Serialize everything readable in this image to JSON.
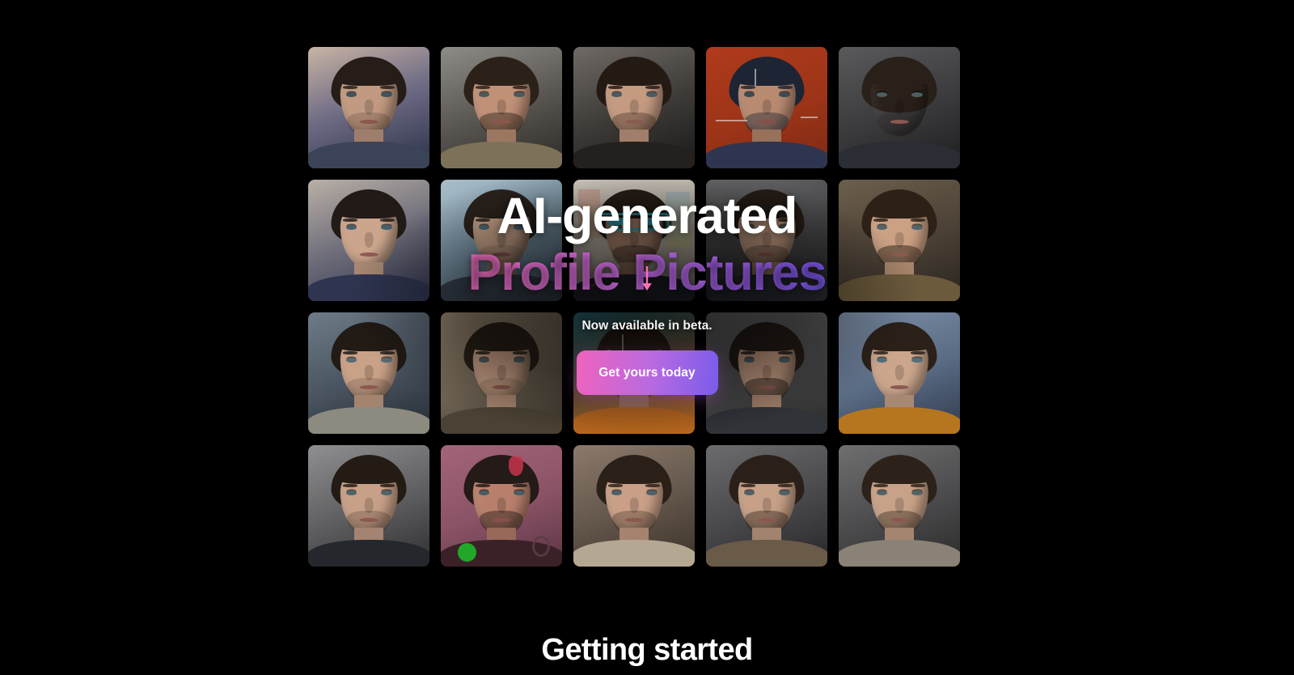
{
  "page": {
    "background_color": "#000000"
  },
  "hero": {
    "headline_line1": "AI-generated",
    "headline_line2": "Profile Pictures",
    "subhead": "Now available in beta.",
    "cta_label": "Get yours today",
    "scroll_hint_icon": "arrow-down-icon",
    "colors": {
      "gradient_start": "#f56fc0",
      "gradient_mid": "#c46ae4",
      "gradient_end": "#7a57f0",
      "button_start": "#ef63bd",
      "button_end": "#7a5ceb",
      "arrow": "#f472b6",
      "headline_text": "#ffffff",
      "subhead_text": "#f2f2f2"
    },
    "gallery": {
      "columns": 5,
      "rows": 4,
      "tiles": [
        {
          "alt": "AI portrait 1",
          "bg": "linear-gradient(160deg,#c9b4a4 0%,#6d6a84 48%,#2b3048 100%)",
          "skin": "#c19a81",
          "hair": "#271d18",
          "cloth": "#3b4358",
          "eye": "#3f5560",
          "lips": "#8a5750",
          "beard": 0.18,
          "accent": "none"
        },
        {
          "alt": "AI portrait 2",
          "bg": "linear-gradient(160deg,#8e8c86 0%,#56534e 55%,#2c2a27 100%)",
          "skin": "#c09077",
          "hair": "#2b2119",
          "cloth": "#7d7259",
          "eye": "#4b5a5c",
          "lips": "#8d564c",
          "beard": 0.45,
          "accent": "none"
        },
        {
          "alt": "AI portrait 3",
          "bg": "linear-gradient(160deg,#6f6a66 0%,#3b3835 55%,#1b1a19 100%)",
          "skin": "#c49a80",
          "hair": "#241a14",
          "cloth": "#24201d",
          "eye": "#4a5b61",
          "lips": "#8b5a51",
          "beard": 0.32,
          "accent": "none"
        },
        {
          "alt": "AI portrait 4",
          "bg": "linear-gradient(160deg,#b03a1c 0%,#9c3418 55%,#7d2a13 100%)",
          "skin": "#b88a70",
          "hair": "#1d2433",
          "cloth": "#2d3550",
          "eye": "#3c4a55",
          "lips": "#84504a",
          "beard": 0.42,
          "accent": "lines"
        },
        {
          "alt": "AI portrait 5",
          "bg": "linear-gradient(160deg,#5a5a5c 0%,#3a3a3c 55%,#1e1e20 100%)",
          "skin": "#c09madd",
          "hair": "#2a201a",
          "cloth": "#2a2d33",
          "eye": "#4d5e63",
          "lips": "#8b5850",
          "beard": 0.2,
          "accent": "none"
        },
        {
          "alt": "AI portrait 6",
          "bg": "linear-gradient(160deg,#b9b0a6 0%,#6b6a78 52%,#31364d 100%)",
          "skin": "#cba58c",
          "hair": "#221a16",
          "cloth": "#2f3550",
          "eye": "#46606c",
          "lips": "#8e5c55",
          "beard": 0.0,
          "accent": "none"
        },
        {
          "alt": "AI portrait 7",
          "bg": "linear-gradient(160deg,#a9bdc9 0%,#7b96a8 52%,#4c6173 100%)",
          "skin": "#cfa88e",
          "hair": "#2b221c",
          "cloth": "#3a4450",
          "eye": "#50707c",
          "lips": "#8f5d54",
          "beard": 0.12,
          "accent": "none"
        },
        {
          "alt": "AI portrait 8",
          "bg": "linear-gradient(160deg,#ddd6cb 0%,#c8bfb2 52%,#a89c8d 100%)",
          "skin": "#c79a7e",
          "hair": "#2a2018",
          "cloth": "#262b33",
          "eye": "#3f5a63",
          "lips": "#8a564d",
          "beard": 0.4,
          "accent": "cyber"
        },
        {
          "alt": "AI portrait 9",
          "bg": "linear-gradient(160deg,#6b6b6d 0%,#404042 55%,#232325 100%)",
          "skin": "#c49c83",
          "hair": "#241b15",
          "cloth": "#2b2e34",
          "eye": "#4b5e64",
          "lips": "#8b5950",
          "beard": 0.3,
          "accent": "none"
        },
        {
          "alt": "AI portrait 10",
          "bg": "linear-gradient(160deg,#6d5f4c 0%,#4a4035 55%,#2a251e 100%)",
          "skin": "#cba083",
          "hair": "#2d2117",
          "cloth": "#6b5a3c",
          "eye": "#52656a",
          "lips": "#8e5a50",
          "beard": 0.5,
          "accent": "none"
        },
        {
          "alt": "AI portrait 11",
          "bg": "linear-gradient(160deg,#6f7b88 0%,#47525e 55%,#242a31 100%)",
          "skin": "#c9a187",
          "hair": "#211a15",
          "cloth": "#8d8a80",
          "eye": "#566c74",
          "lips": "#8c5950",
          "beard": 0.16,
          "accent": "none"
        },
        {
          "alt": "AI portrait 12",
          "bg": "linear-gradient(160deg,#9d8c74 0%,#6d6252 55%,#3a352c 100%)",
          "skin": "#c9a086",
          "hair": "#2a2018",
          "cloth": "#4a4234",
          "eye": "#4e6067",
          "lips": "#8b5850",
          "beard": 0.14,
          "accent": "none"
        },
        {
          "alt": "AI portrait 13",
          "bg": "linear-gradient(160deg,#2e7a8e 0%,#7a5a34 52%,#b86a22 100%)",
          "skin": "#c2926f",
          "hair": "#2c2017",
          "cloth": "#b8671f",
          "eye": "#47606a",
          "lips": "#8a554a",
          "beard": 0.45,
          "accent": "lines"
        },
        {
          "alt": "AI portrait 14",
          "bg": "linear-gradient(160deg,#6e6e70 0%,#49494b 55%,#292929 100%)",
          "skin": "#c39a80",
          "hair": "#241c16",
          "cloth": "#303338",
          "eye": "#4c5f66",
          "lips": "#8a5850",
          "beard": 0.5,
          "accent": "none"
        },
        {
          "alt": "AI portrait 15",
          "bg": "linear-gradient(160deg,#7e8fa8 0%,#5a6b84 52%,#303a4e 100%)",
          "skin": "#cba68d",
          "hair": "#2b2119",
          "cloth": "#b5761f",
          "eye": "#52707d",
          "lips": "#8d5b52",
          "beard": 0.0,
          "accent": "none"
        },
        {
          "alt": "AI portrait 16",
          "bg": "linear-gradient(160deg,#8f8f91 0%,#5c5c5e 55%,#2e2e30 100%)",
          "skin": "#c8a088",
          "hair": "#241b15",
          "cloth": "#24272c",
          "eye": "#506469",
          "lips": "#8b5950",
          "beard": 0.22,
          "accent": "none"
        },
        {
          "alt": "AI portrait 17",
          "bg": "linear-gradient(160deg,#a3647a 0%,#8b5366 52%,#5c3445 100%)",
          "skin": "#b8806c",
          "hair": "#241a18",
          "cloth": "#3a2128",
          "eye": "#4a5c63",
          "lips": "#8a4f4a",
          "beard": 0.46,
          "accent": "pinkroom"
        },
        {
          "alt": "AI portrait 18",
          "bg": "linear-gradient(160deg,#8c7a6c 0%,#63564b 52%,#3a3229 100%)",
          "skin": "#c9a087",
          "hair": "#2b2018",
          "cloth": "#b5a893",
          "eye": "#4e6167",
          "lips": "#8b5850",
          "beard": 0.3,
          "accent": "none"
        },
        {
          "alt": "AI portrait 19",
          "bg": "linear-gradient(160deg,#6c6c6e 0%,#47474a 55%,#27272a 100%)",
          "skin": "#c6a087",
          "hair": "#2a2019",
          "cloth": "#6a5a48",
          "eye": "#4e6268",
          "lips": "#8b5850",
          "beard": 0.42,
          "accent": "none"
        },
        {
          "alt": "AI portrait 20",
          "bg": "linear-gradient(160deg,#6f6f70 0%,#4a4a4c 55%,#2b2b2c 100%)",
          "skin": "#c8a288",
          "hair": "#2c221a",
          "cloth": "#8a8276",
          "eye": "#516568",
          "lips": "#8c5950",
          "beard": 0.4,
          "accent": "none"
        }
      ]
    }
  },
  "next_section": {
    "title": "Getting started"
  }
}
